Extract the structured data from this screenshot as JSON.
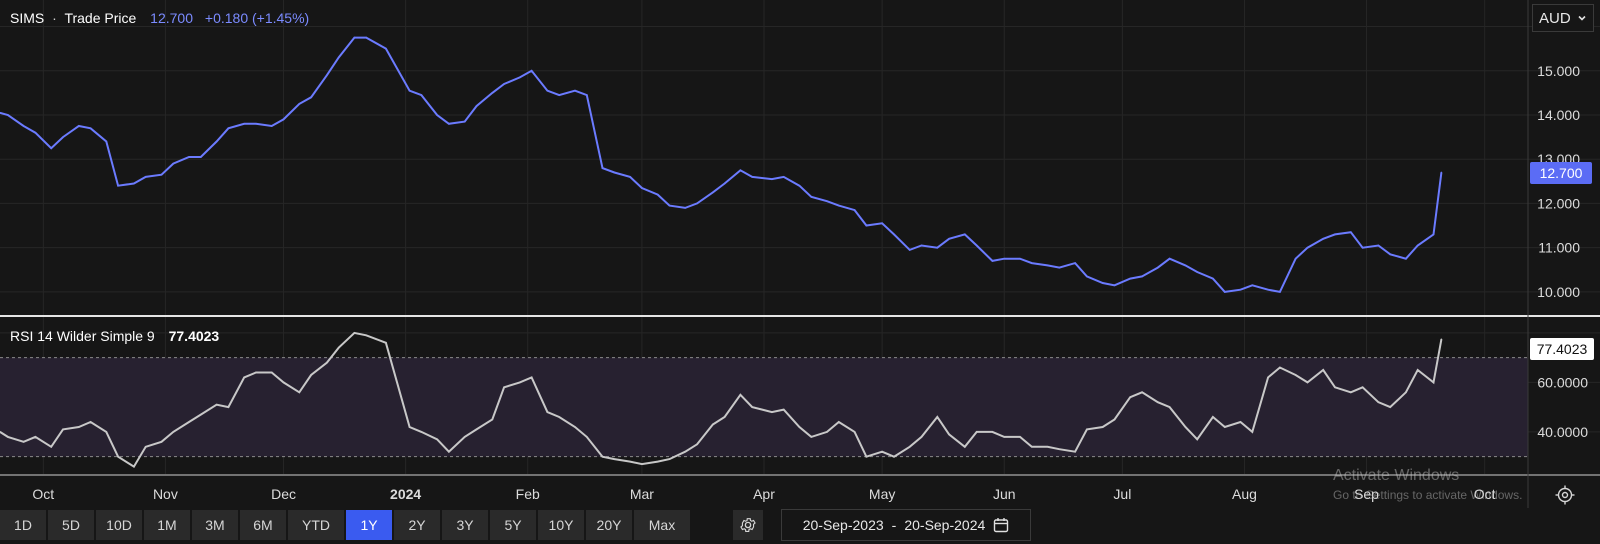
{
  "currency": {
    "value": "AUD",
    "icon": "chevron-down-icon"
  },
  "price_legend": {
    "symbol": "SIMS",
    "separator": "·",
    "name": "Trade Price",
    "last": "12.700",
    "change": "+0.180 (+1.45%)"
  },
  "rsi_legend": {
    "name": "RSI 14 Wilder Simple 9",
    "value": "77.4023"
  },
  "price_badge": "12.700",
  "rsi_badge": "77.4023",
  "toolbar": {
    "ranges": [
      "1D",
      "5D",
      "10D",
      "1M",
      "3M",
      "6M",
      "YTD",
      "1Y",
      "2Y",
      "3Y",
      "5Y",
      "10Y",
      "20Y",
      "Max"
    ],
    "active": "1Y",
    "settings_icon": "gear-icon"
  },
  "date_range": {
    "start": "20-Sep-2023",
    "dash": "-",
    "end": "20-Sep-2024",
    "icon": "calendar-icon"
  },
  "watermark": {
    "line1": "Activate Windows",
    "line2": "Go to Settings to activate Windows."
  },
  "colors": {
    "price_line": "#6b7bff",
    "rsi_line": "#c8c8c8",
    "rsi_band": "#272130",
    "background": "#161616",
    "active_button": "#3a5bf0"
  },
  "chart_data": [
    {
      "type": "line",
      "title": "SIMS · Trade Price",
      "ylim": [
        9.5,
        16.6
      ],
      "y_ticks": [
        "10.000",
        "11.000",
        "12.000",
        "13.000",
        "14.000",
        "15.000"
      ],
      "x_ticks": [
        "Oct",
        "Nov",
        "Dec",
        "2024",
        "Feb",
        "Mar",
        "Apr",
        "May",
        "Jun",
        "Jul",
        "Aug",
        "Sep",
        "Oct"
      ],
      "series": [
        {
          "name": "Trade Price",
          "x": [
            "2023-09-20",
            "2023-09-22",
            "2023-09-26",
            "2023-09-29",
            "2023-10-03",
            "2023-10-06",
            "2023-10-10",
            "2023-10-13",
            "2023-10-17",
            "2023-10-20",
            "2023-10-24",
            "2023-10-27",
            "2023-10-31",
            "2023-11-03",
            "2023-11-07",
            "2023-11-10",
            "2023-11-14",
            "2023-11-17",
            "2023-11-21",
            "2023-11-24",
            "2023-11-28",
            "2023-12-01",
            "2023-12-05",
            "2023-12-08",
            "2023-12-12",
            "2023-12-15",
            "2023-12-19",
            "2023-12-22",
            "2023-12-27",
            "2024-01-02",
            "2024-01-05",
            "2024-01-09",
            "2024-01-12",
            "2024-01-16",
            "2024-01-19",
            "2024-01-23",
            "2024-01-26",
            "2024-01-30",
            "2024-02-02",
            "2024-02-06",
            "2024-02-09",
            "2024-02-13",
            "2024-02-16",
            "2024-02-20",
            "2024-02-23",
            "2024-02-27",
            "2024-03-01",
            "2024-03-05",
            "2024-03-08",
            "2024-03-12",
            "2024-03-15",
            "2024-03-19",
            "2024-03-22",
            "2024-03-26",
            "2024-03-29",
            "2024-04-03",
            "2024-04-06",
            "2024-04-10",
            "2024-04-13",
            "2024-04-17",
            "2024-04-20",
            "2024-04-24",
            "2024-04-27",
            "2024-05-01",
            "2024-05-04",
            "2024-05-08",
            "2024-05-11",
            "2024-05-15",
            "2024-05-18",
            "2024-05-22",
            "2024-05-25",
            "2024-05-29",
            "2024-06-01",
            "2024-06-05",
            "2024-06-08",
            "2024-06-12",
            "2024-06-15",
            "2024-06-19",
            "2024-06-22",
            "2024-06-26",
            "2024-06-29",
            "2024-07-03",
            "2024-07-06",
            "2024-07-10",
            "2024-07-13",
            "2024-07-17",
            "2024-07-20",
            "2024-07-24",
            "2024-07-27",
            "2024-07-31",
            "2024-08-03",
            "2024-08-07",
            "2024-08-10",
            "2024-08-14",
            "2024-08-17",
            "2024-08-21",
            "2024-08-24",
            "2024-08-28",
            "2024-08-31",
            "2024-09-04",
            "2024-09-07",
            "2024-09-11",
            "2024-09-14",
            "2024-09-18",
            "2024-09-20"
          ],
          "values": [
            14.05,
            14.0,
            13.75,
            13.6,
            13.25,
            13.5,
            13.75,
            13.7,
            13.4,
            12.4,
            12.45,
            12.6,
            12.65,
            12.9,
            13.05,
            13.05,
            13.4,
            13.7,
            13.8,
            13.8,
            13.75,
            13.9,
            14.25,
            14.4,
            14.9,
            15.3,
            15.75,
            15.75,
            15.5,
            14.55,
            14.45,
            14.0,
            13.8,
            13.85,
            14.2,
            14.5,
            14.7,
            14.85,
            15.0,
            14.55,
            14.45,
            14.55,
            14.45,
            12.8,
            12.7,
            12.6,
            12.35,
            12.2,
            11.95,
            11.9,
            12.0,
            12.25,
            12.45,
            12.75,
            12.6,
            12.55,
            12.6,
            12.4,
            12.15,
            12.05,
            11.95,
            11.85,
            11.5,
            11.55,
            11.3,
            10.95,
            11.05,
            11.0,
            11.2,
            11.3,
            11.05,
            10.7,
            10.75,
            10.75,
            10.65,
            10.6,
            10.55,
            10.65,
            10.35,
            10.2,
            10.15,
            10.3,
            10.35,
            10.55,
            10.75,
            10.6,
            10.45,
            10.3,
            10.0,
            10.05,
            10.15,
            10.05,
            10.0,
            10.75,
            11.0,
            11.2,
            11.3,
            11.35,
            11.0,
            11.05,
            10.85,
            10.75,
            11.05,
            11.3,
            12.7
          ]
        }
      ]
    },
    {
      "type": "line",
      "title": "RSI 14 Wilder Simple 9",
      "ylim": [
        23,
        86
      ],
      "y_ticks": [
        "40.0000",
        "60.0000"
      ],
      "bands": [
        30,
        70
      ],
      "series": [
        {
          "name": "RSI 14 Wilder Simple 9",
          "x": [
            "2023-09-20",
            "2023-09-22",
            "2023-09-26",
            "2023-09-29",
            "2023-10-03",
            "2023-10-06",
            "2023-10-10",
            "2023-10-13",
            "2023-10-17",
            "2023-10-20",
            "2023-10-24",
            "2023-10-27",
            "2023-10-31",
            "2023-11-03",
            "2023-11-07",
            "2023-11-10",
            "2023-11-14",
            "2023-11-17",
            "2023-11-21",
            "2023-11-24",
            "2023-11-28",
            "2023-12-01",
            "2023-12-05",
            "2023-12-08",
            "2023-12-12",
            "2023-12-15",
            "2023-12-19",
            "2023-12-22",
            "2023-12-27",
            "2024-01-02",
            "2024-01-05",
            "2024-01-09",
            "2024-01-12",
            "2024-01-16",
            "2024-01-19",
            "2024-01-23",
            "2024-01-26",
            "2024-01-30",
            "2024-02-02",
            "2024-02-06",
            "2024-02-09",
            "2024-02-13",
            "2024-02-16",
            "2024-02-20",
            "2024-02-23",
            "2024-02-27",
            "2024-03-01",
            "2024-03-05",
            "2024-03-08",
            "2024-03-12",
            "2024-03-15",
            "2024-03-19",
            "2024-03-22",
            "2024-03-26",
            "2024-03-29",
            "2024-04-03",
            "2024-04-06",
            "2024-04-10",
            "2024-04-13",
            "2024-04-17",
            "2024-04-20",
            "2024-04-24",
            "2024-04-27",
            "2024-05-01",
            "2024-05-04",
            "2024-05-08",
            "2024-05-11",
            "2024-05-15",
            "2024-05-18",
            "2024-05-22",
            "2024-05-25",
            "2024-05-29",
            "2024-06-01",
            "2024-06-05",
            "2024-06-08",
            "2024-06-12",
            "2024-06-15",
            "2024-06-19",
            "2024-06-22",
            "2024-06-26",
            "2024-06-29",
            "2024-07-03",
            "2024-07-06",
            "2024-07-10",
            "2024-07-13",
            "2024-07-17",
            "2024-07-20",
            "2024-07-24",
            "2024-07-27",
            "2024-07-31",
            "2024-08-03",
            "2024-08-07",
            "2024-08-10",
            "2024-08-14",
            "2024-08-17",
            "2024-08-21",
            "2024-08-24",
            "2024-08-28",
            "2024-08-31",
            "2024-09-04",
            "2024-09-07",
            "2024-09-11",
            "2024-09-14",
            "2024-09-18",
            "2024-09-20"
          ],
          "values": [
            40,
            38,
            36,
            38,
            34,
            41,
            42,
            44,
            40,
            30,
            26,
            34,
            36,
            40,
            44,
            47,
            51,
            50,
            62,
            64,
            64,
            60,
            56,
            63,
            68,
            74,
            80,
            79,
            76,
            42,
            40,
            37,
            32,
            38,
            41,
            45,
            58,
            60,
            62,
            48,
            46,
            42,
            38,
            30,
            29,
            28,
            27,
            28,
            29,
            32,
            35,
            43,
            46,
            55,
            50,
            48,
            49,
            42,
            38,
            40,
            44,
            40,
            30,
            32,
            30,
            34,
            38,
            46,
            39,
            34,
            40,
            40,
            38,
            38,
            34,
            34,
            33,
            32,
            41,
            42,
            45,
            54,
            56,
            52,
            50,
            42,
            37,
            46,
            42,
            44,
            40,
            62,
            66,
            63,
            60,
            65,
            58,
            56,
            58,
            52,
            50,
            56,
            65,
            60,
            77.4
          ]
        }
      ]
    }
  ]
}
